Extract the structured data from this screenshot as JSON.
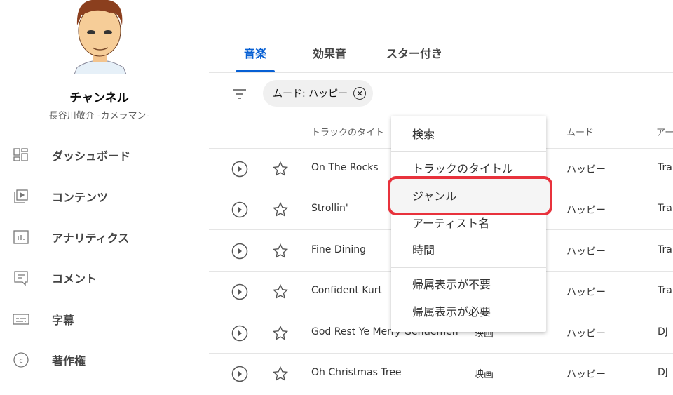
{
  "sidebar": {
    "channel_title": "チャンネル",
    "channel_name": "長谷川敬介 -カメラマン-",
    "items": [
      {
        "label": "ダッシュボード",
        "icon": "dashboard-icon"
      },
      {
        "label": "コンテンツ",
        "icon": "content-icon"
      },
      {
        "label": "アナリティクス",
        "icon": "analytics-icon"
      },
      {
        "label": "コメント",
        "icon": "comment-icon"
      },
      {
        "label": "字幕",
        "icon": "subtitles-icon"
      },
      {
        "label": "著作権",
        "icon": "copyright-icon"
      }
    ]
  },
  "tabs": [
    {
      "label": "音楽",
      "active": true
    },
    {
      "label": "効果音"
    },
    {
      "label": "スター付き"
    }
  ],
  "filter": {
    "chip": "ムード: ハッピー"
  },
  "table": {
    "headers": {
      "title": "トラックのタイト",
      "mood": "ムード",
      "artist": "アー"
    },
    "rows": [
      {
        "title": "On The Rocks",
        "genre": "",
        "mood": "ハッピー",
        "artist": "Tra"
      },
      {
        "title": "Strollin'",
        "genre": "",
        "mood": "ハッピー",
        "artist": "Tra"
      },
      {
        "title": "Fine Dining",
        "genre": "",
        "mood": "ハッピー",
        "artist": "Tra"
      },
      {
        "title": "Confident Kurt",
        "genre": "",
        "mood": "ハッピー",
        "artist": "Tra"
      },
      {
        "title": "God Rest Ye Merry Gentlemen",
        "genre": "映画",
        "mood": "ハッピー",
        "artist": "DJ"
      },
      {
        "title": "Oh Christmas Tree",
        "genre": "映画",
        "mood": "ハッピー",
        "artist": "DJ"
      }
    ]
  },
  "menu": {
    "items": [
      "検索",
      "トラックのタイトル",
      "ジャンル",
      "アーティスト名",
      "時間",
      "帰属表示が不要",
      "帰属表示が必要"
    ],
    "highlighted": "ジャンル",
    "highlight_color": "#e8323c"
  },
  "colors": {
    "accent": "#065fd4"
  }
}
